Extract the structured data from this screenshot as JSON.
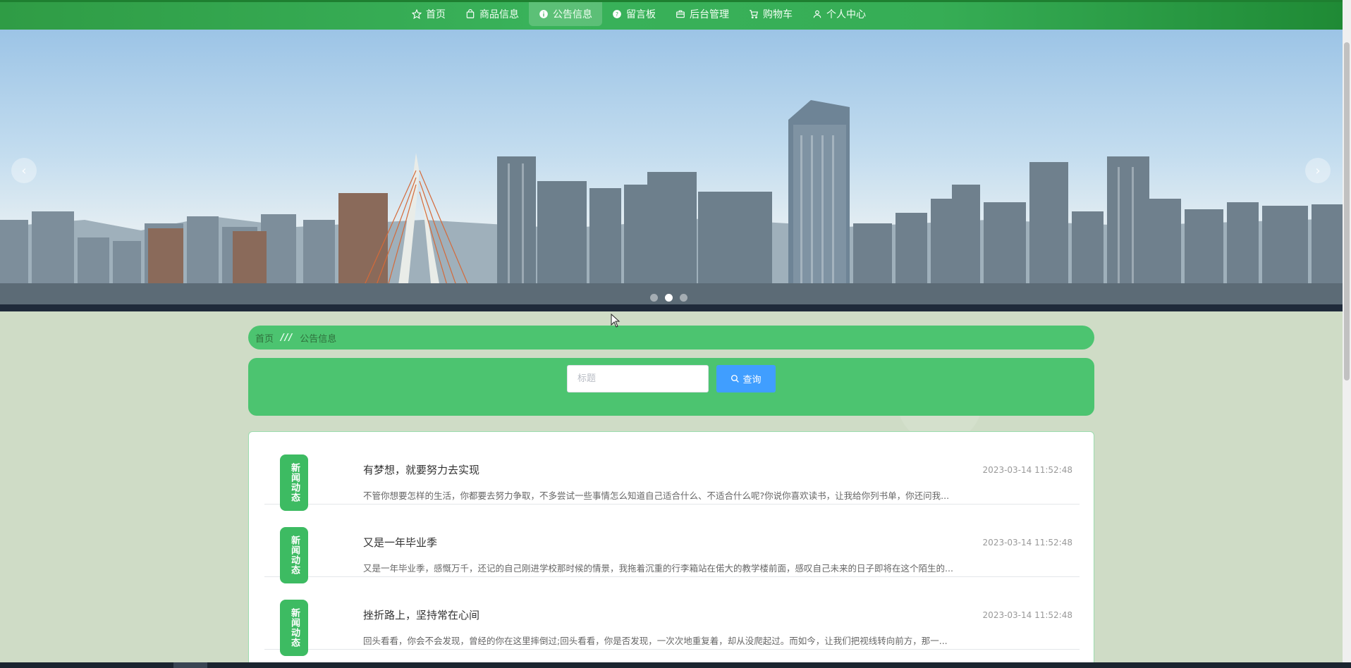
{
  "nav": {
    "items": [
      {
        "label": "首页",
        "icon": "star-icon",
        "active": false
      },
      {
        "label": "商品信息",
        "icon": "bag-icon",
        "active": false
      },
      {
        "label": "公告信息",
        "icon": "info-circle-icon",
        "active": true
      },
      {
        "label": "留言板",
        "icon": "question-circle-icon",
        "active": false
      },
      {
        "label": "后台管理",
        "icon": "briefcase-icon",
        "active": false
      },
      {
        "label": "购物车",
        "icon": "cart-icon",
        "active": false
      },
      {
        "label": "个人中心",
        "icon": "user-icon",
        "active": false
      }
    ]
  },
  "banner": {
    "prev_label": "‹",
    "next_label": "›",
    "dots": 3,
    "active_dot": 1
  },
  "breadcrumb": {
    "home": "首页",
    "separator": "///",
    "current": "公告信息"
  },
  "search": {
    "placeholder": "标题",
    "value": "",
    "button_label": "查询"
  },
  "news": [
    {
      "badge": "新闻动态",
      "title": "有梦想，就要努力去实现",
      "date": "2023-03-14 11:52:48",
      "desc": "不管你想要怎样的生活，你都要去努力争取，不多尝试一些事情怎么知道自己适合什么、不适合什么呢?你说你喜欢读书，让我给你列书单，你还问我..."
    },
    {
      "badge": "新闻动态",
      "title": "又是一年毕业季",
      "date": "2023-03-14 11:52:48",
      "desc": "又是一年毕业季，感慨万千，还记的自己刚进学校那时候的情景，我拖着沉重的行李箱站在偌大的教学楼前面，感叹自己未来的日子即将在这个陌生的..."
    },
    {
      "badge": "新闻动态",
      "title": "挫折路上，坚持常在心间",
      "date": "2023-03-14 11:52:48",
      "desc": "回头看看，你会不会发现，曾经的你在这里摔倒过;回头看看，你是否发现，一次次地重复着，却从没爬起过。而如今，让我们把视线转向前方，那一..."
    }
  ],
  "colors": {
    "nav_green": "#36ad55",
    "panel_green": "#4cc470",
    "badge_green": "#3dbb62",
    "search_blue": "#409eff",
    "page_bg": "#cfdcc6"
  }
}
